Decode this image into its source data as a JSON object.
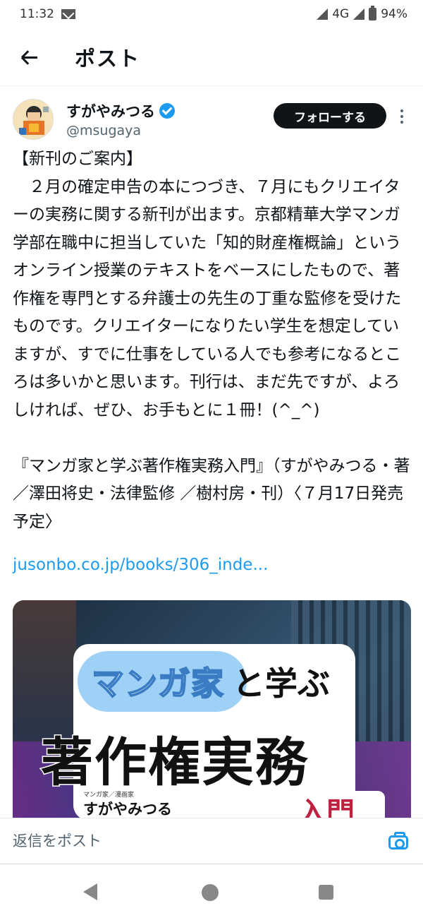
{
  "status_bar": {
    "time": "11:32",
    "network": "4G",
    "battery": "94%",
    "icons": [
      "mail-icon",
      "signal-icon",
      "battery-icon"
    ]
  },
  "app_bar": {
    "title": "ポスト",
    "back_icon": "arrow-left-icon"
  },
  "author": {
    "name": "すがやみつる",
    "handle": "@msugaya",
    "verified": true,
    "follow_label": "フォローする"
  },
  "tweet": {
    "text": "【新刊のご案内】\n　２月の確定申告の本につづき、７月にもクリエイターの実務に関する新刊が出ます。京都精華大学マンガ学部在職中に担当していた「知的財産権概論」というオンライン授業のテキストをベースにしたもので、著作権を専門とする弁護士の先生の丁重な監修を受けたものです。クリエイターになりたい学生を想定していますが、すでに仕事をしている人でも参考になるところは多いかと思います。刊行は、まだ先ですが、よろしければ、ぜひ、お手もとに１冊！(^_^)\n\n『マンガ家と学ぶ著作権実務入門』（すがやみつる・著／澤田将史・法律監修 ／樹村房・刊）〈７月17日発売予定〉",
    "link": "jusonbo.co.jp/books/306_inde..."
  },
  "media": {
    "cover_title_small_a": "マンガ家",
    "cover_title_small_b": "と学ぶ",
    "cover_title_big": "著作権実務",
    "cover_sub": "マンガ家／漫画家",
    "cover_author": "すがやみつる",
    "cover_badge": "入門"
  },
  "reply": {
    "placeholder": "返信をポスト",
    "camera_icon": "camera-icon"
  },
  "nav": {
    "icons": [
      "nav-back-icon",
      "nav-home-icon",
      "nav-recent-icon"
    ]
  },
  "colors": {
    "accent": "#1d9bf0",
    "text": "#0f1419",
    "muted": "#536471"
  }
}
